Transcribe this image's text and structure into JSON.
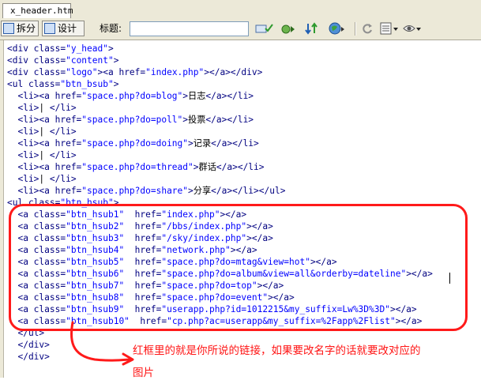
{
  "window": {
    "tab_title": "x_header.htm"
  },
  "toolbar": {
    "split_label": "拆分",
    "design_label": "设计",
    "title_label": "标题:",
    "title_value": "",
    "icons": [
      "validate-icon",
      "debug-icon",
      "refresh-icon",
      "browse-icon",
      "reload-icon",
      "options-icon",
      "view-icon"
    ]
  },
  "code": {
    "lines": [
      [
        [
          "tag",
          "<div class="
        ],
        [
          "val",
          "\"y_head\""
        ],
        [
          "tag",
          ">"
        ]
      ],
      [
        [
          "tag",
          "<div class="
        ],
        [
          "val",
          "\"content\""
        ],
        [
          "tag",
          ">"
        ]
      ],
      [
        [
          "tag",
          "<div class="
        ],
        [
          "val",
          "\"logo\""
        ],
        [
          "tag",
          "><a href="
        ],
        [
          "val",
          "\"index.php\""
        ],
        [
          "tag",
          "></a></div>"
        ]
      ],
      [
        [
          "tag",
          "<ul class="
        ],
        [
          "val",
          "\"btn_bsub\""
        ],
        [
          "tag",
          ">"
        ]
      ],
      [
        [
          "tag",
          "  <li><a href="
        ],
        [
          "val",
          "\"space.php?do=blog\""
        ],
        [
          "tag",
          ">"
        ],
        [
          "txt",
          "日志"
        ],
        [
          "tag",
          "</a></li>"
        ]
      ],
      [
        [
          "tag",
          "  <li>"
        ],
        [
          "txt",
          "| "
        ],
        [
          "tag",
          "</li>"
        ]
      ],
      [
        [
          "tag",
          "  <li><a href="
        ],
        [
          "val",
          "\"space.php?do=poll\""
        ],
        [
          "tag",
          ">"
        ],
        [
          "txt",
          "投票"
        ],
        [
          "tag",
          "</a></li>"
        ]
      ],
      [
        [
          "tag",
          "  <li>"
        ],
        [
          "txt",
          "| "
        ],
        [
          "tag",
          "</li>"
        ]
      ],
      [
        [
          "tag",
          "  <li><a href="
        ],
        [
          "val",
          "\"space.php?do=doing\""
        ],
        [
          "tag",
          ">"
        ],
        [
          "txt",
          "记录"
        ],
        [
          "tag",
          "</a></li>"
        ]
      ],
      [
        [
          "tag",
          "  <li>"
        ],
        [
          "txt",
          "| "
        ],
        [
          "tag",
          "</li>"
        ]
      ],
      [
        [
          "tag",
          "  <li><a href="
        ],
        [
          "val",
          "\"space.php?do=thread\""
        ],
        [
          "tag",
          ">"
        ],
        [
          "txt",
          "群话"
        ],
        [
          "tag",
          "</a></li>"
        ]
      ],
      [
        [
          "tag",
          "  <li>"
        ],
        [
          "txt",
          "| "
        ],
        [
          "tag",
          "</li>"
        ]
      ],
      [
        [
          "tag",
          "  <li><a href="
        ],
        [
          "val",
          "\"space.php?do=share\""
        ],
        [
          "tag",
          ">"
        ],
        [
          "txt",
          "分享"
        ],
        [
          "tag",
          "</a></li></ul>"
        ]
      ],
      [
        [
          "tag",
          "<ul class="
        ],
        [
          "val",
          "\"btn_hsub\""
        ],
        [
          "tag",
          ">"
        ]
      ],
      [
        [
          "tag",
          "  <a class="
        ],
        [
          "val",
          "\"btn_hsub1\""
        ],
        [
          "tag",
          "  href="
        ],
        [
          "val",
          "\"index.php\""
        ],
        [
          "tag",
          "></a>"
        ]
      ],
      [
        [
          "tag",
          "  <a class="
        ],
        [
          "val",
          "\"btn_hsub2\""
        ],
        [
          "tag",
          "  href="
        ],
        [
          "val",
          "\"/bbs/index.php\""
        ],
        [
          "tag",
          "></a>"
        ]
      ],
      [
        [
          "tag",
          "  <a class="
        ],
        [
          "val",
          "\"btn_hsub3\""
        ],
        [
          "tag",
          "  href="
        ],
        [
          "val",
          "\"/sky/index.php\""
        ],
        [
          "tag",
          "></a>"
        ]
      ],
      [
        [
          "tag",
          "  <a class="
        ],
        [
          "val",
          "\"btn_hsub4\""
        ],
        [
          "tag",
          "  href="
        ],
        [
          "val",
          "\"network.php\""
        ],
        [
          "tag",
          "></a>"
        ]
      ],
      [
        [
          "tag",
          "  <a class="
        ],
        [
          "val",
          "\"btn_hsub5\""
        ],
        [
          "tag",
          "  href="
        ],
        [
          "val",
          "\"space.php?do=mtag&view=hot\""
        ],
        [
          "tag",
          "></a>"
        ]
      ],
      [
        [
          "tag",
          "  <a class="
        ],
        [
          "val",
          "\"btn_hsub6\""
        ],
        [
          "tag",
          "  href="
        ],
        [
          "val",
          "\"space.php?do=album&view=all&orderby=dateline\""
        ],
        [
          "tag",
          "></a>"
        ]
      ],
      [
        [
          "tag",
          "  <a class="
        ],
        [
          "val",
          "\"btn_hsub7\""
        ],
        [
          "tag",
          "  href="
        ],
        [
          "val",
          "\"space.php?do=top\""
        ],
        [
          "tag",
          "></a>"
        ]
      ],
      [
        [
          "tag",
          "  <a class="
        ],
        [
          "val",
          "\"btn_hsub8\""
        ],
        [
          "tag",
          "  href="
        ],
        [
          "val",
          "\"space.php?do=event\""
        ],
        [
          "tag",
          "></a>"
        ]
      ],
      [
        [
          "tag",
          "  <a class="
        ],
        [
          "val",
          "\"btn_hsub9\""
        ],
        [
          "tag",
          "  href="
        ],
        [
          "val",
          "\"userapp.php?id=1012215&my_suffix=Lw%3D%3D\""
        ],
        [
          "tag",
          "></a>"
        ]
      ],
      [
        [
          "tag",
          "  <a class="
        ],
        [
          "val",
          "\"btn_hsub10\""
        ],
        [
          "tag",
          "  href="
        ],
        [
          "val",
          "\"cp.php?ac=userapp&my_suffix=%2Fapp%2Flist\""
        ],
        [
          "tag",
          "></a>"
        ]
      ],
      [
        [
          "tag",
          "  </ul>"
        ]
      ],
      [
        [
          "tag",
          "  </div>"
        ]
      ],
      [
        [
          "tag",
          "  </div>"
        ]
      ]
    ]
  },
  "annotation": {
    "text_line1": "红框里的就是你所说的链接，如果要改名字的话就要改对应的",
    "text_line2": "图片",
    "color": "#ff1414"
  }
}
